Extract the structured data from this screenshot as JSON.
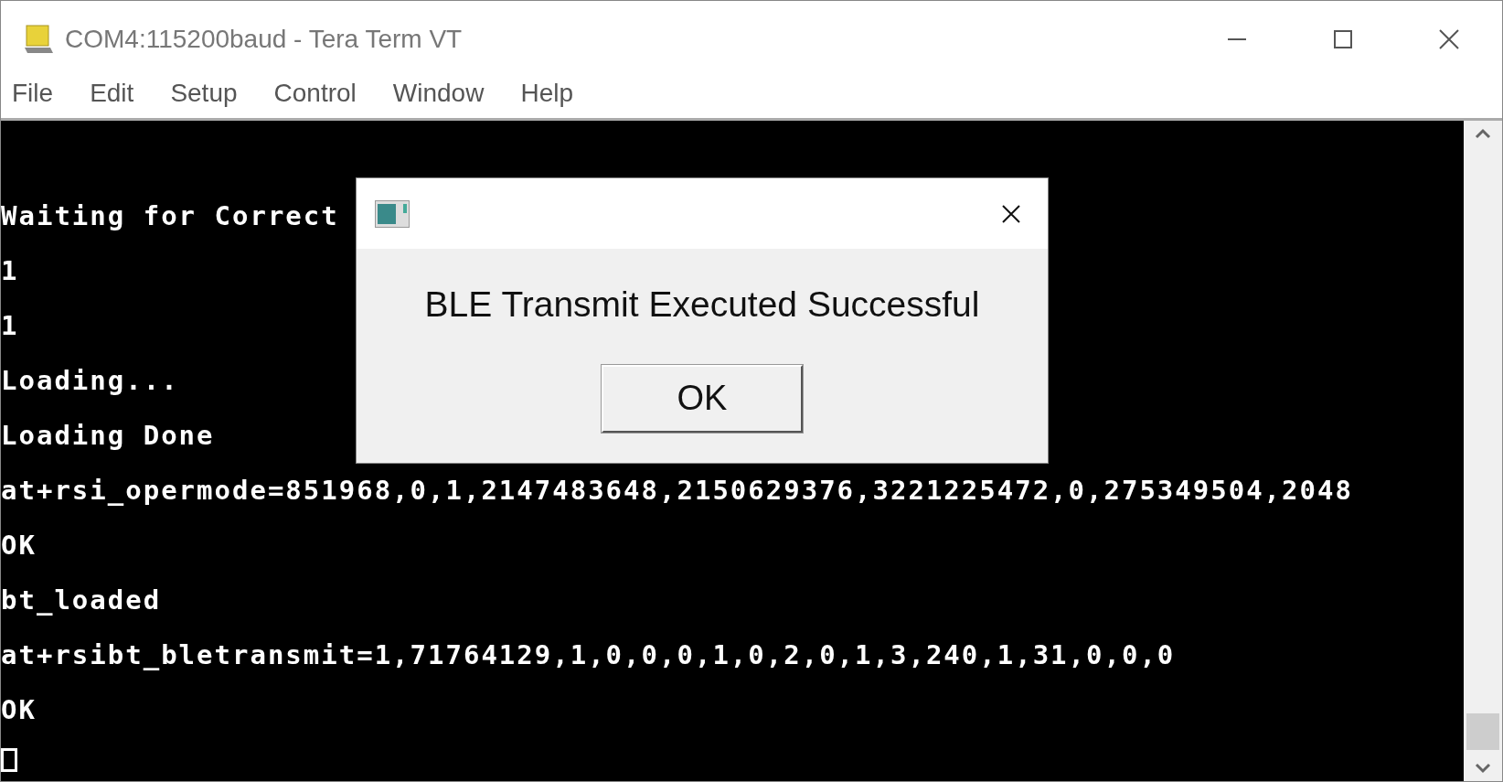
{
  "window": {
    "title": "COM4:115200baud - Tera Term VT"
  },
  "menu": [
    "File",
    "Edit",
    "Setup",
    "Control",
    "Window",
    "Help"
  ],
  "terminal": {
    "lines": [
      "Waiting for Correct",
      "1",
      "1",
      "Loading...",
      "Loading Done",
      "at+rsi_opermode=851968,0,1,2147483648,2150629376,3221225472,0,275349504,2048",
      "OK",
      "bt_loaded",
      "at+rsibt_bletransmit=1,71764129,1,0,0,0,1,0,2,0,1,3,240,1,31,0,0,0",
      "OK"
    ]
  },
  "dialog": {
    "message": "BLE Transmit Executed Successful",
    "buttons": [
      "OK"
    ]
  }
}
